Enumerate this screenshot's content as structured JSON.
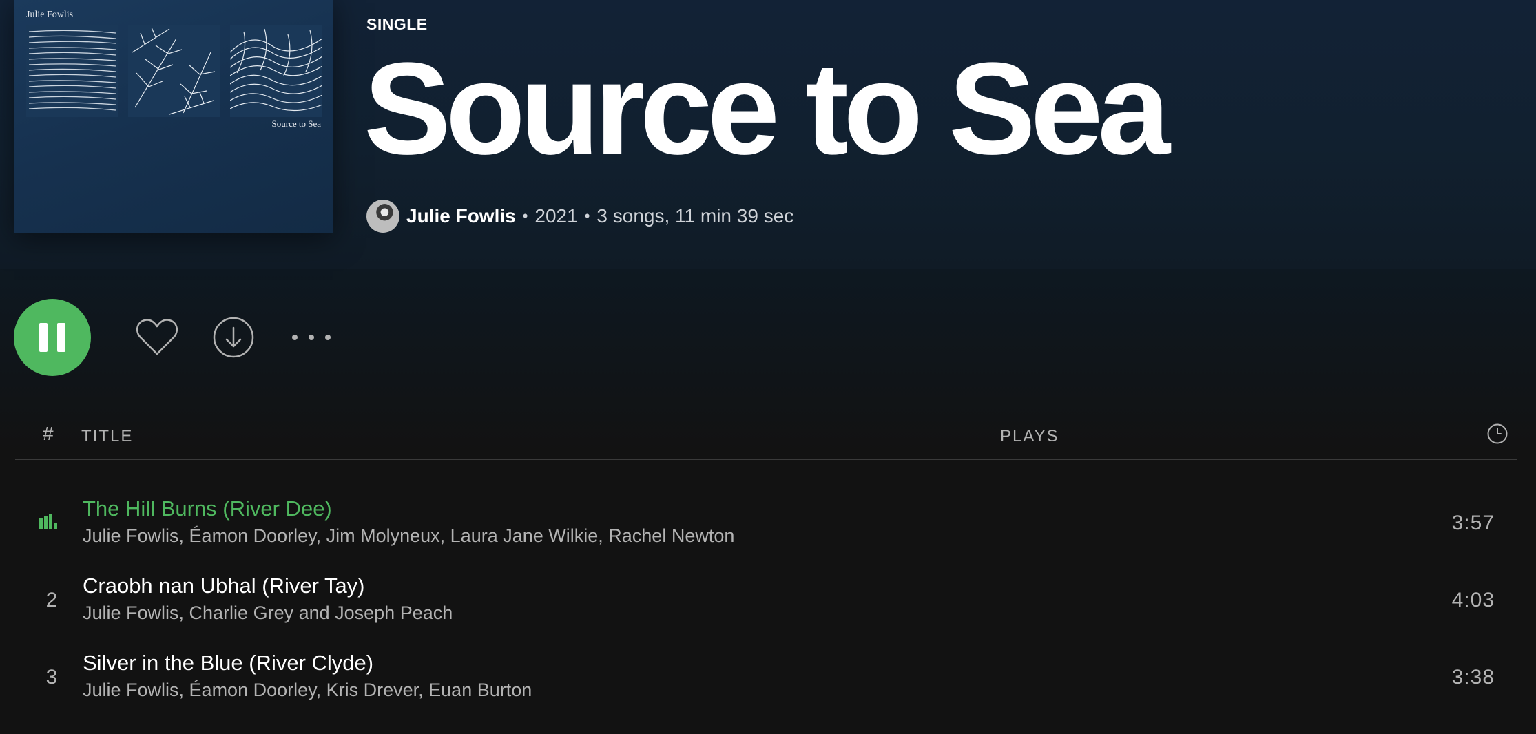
{
  "header": {
    "type_label": "SINGLE",
    "album_title": "Source to Sea",
    "artist": "Julie Fowlis",
    "year": "2021",
    "summary": "3 songs, 11 min 39 sec",
    "separator": "•"
  },
  "cover": {
    "artist_text": "Julie Fowlis",
    "title_text": "Source to Sea"
  },
  "actions": {
    "play_state": "playing",
    "accent_color": "#4fb85f"
  },
  "list_header": {
    "number": "#",
    "title": "TITLE",
    "plays": "PLAYS",
    "duration_icon": "clock-icon"
  },
  "tracks": [
    {
      "number": "1",
      "title": "The Hill Burns (River Dee)",
      "artists": "Julie Fowlis, Éamon Doorley, Jim Molyneux, Laura Jane Wilkie, Rachel Newton",
      "duration": "3:57",
      "now_playing": true
    },
    {
      "number": "2",
      "title": "Craobh nan Ubhal (River Tay)",
      "artists": "Julie Fowlis, Charlie Grey and Joseph Peach",
      "duration": "4:03",
      "now_playing": false
    },
    {
      "number": "3",
      "title": "Silver in the Blue (River Clyde)",
      "artists": "Julie Fowlis, Éamon Doorley, Kris Drever, Euan Burton",
      "duration": "3:38",
      "now_playing": false
    }
  ]
}
